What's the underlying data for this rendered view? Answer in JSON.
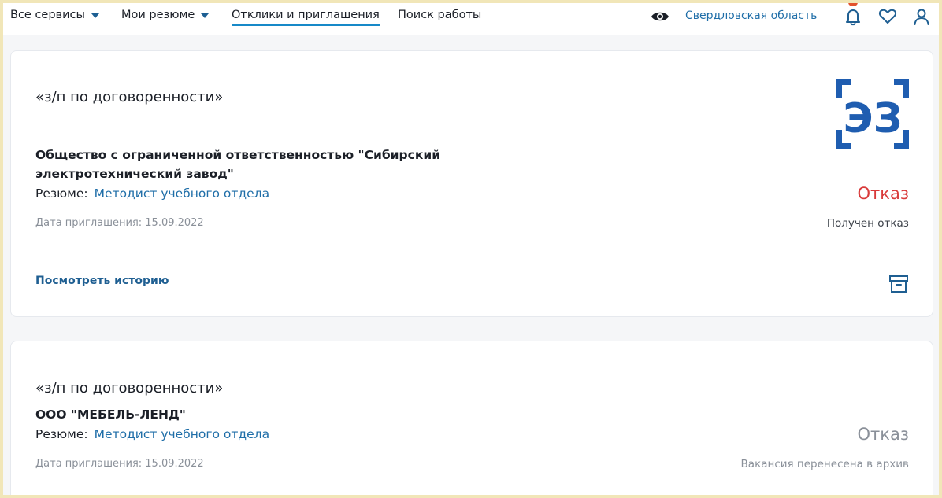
{
  "header": {
    "nav": [
      {
        "label": "Все сервисы",
        "has_dropdown": true
      },
      {
        "label": "Мои резюме",
        "has_dropdown": true
      },
      {
        "label": "Отклики и приглашения",
        "active": true
      },
      {
        "label": "Поиск работы"
      }
    ],
    "region": "Свердловская область",
    "icons": [
      "eye-icon",
      "bell-icon",
      "heart-icon",
      "user-icon"
    ],
    "accent_color": "#1789c8"
  },
  "responses": [
    {
      "salary": "«з/п по договоренности»",
      "company": "Общество с ограниченной ответственностью \"Сибирский электротехнический завод\"",
      "resume_label": "Резюме:",
      "resume_title": "Методист учебного отдела",
      "date": "Дата приглашения: 15.09.2022",
      "status": "Отказ",
      "status_note": "Получен отказ",
      "status_color": "#d93a3a",
      "history_link": "Посмотреть историю",
      "logo_text": "ЭЗ"
    },
    {
      "salary": "«з/п по договоренности»",
      "company": "ООО \"МЕБЕЛЬ-ЛЕНД\"",
      "resume_label": "Резюме:",
      "resume_title": "Методист учебного отдела",
      "date": "Дата приглашения: 15.09.2022",
      "status": "Отказ",
      "status_note": "Вакансия перенесена в архив",
      "status_color": "#8a9099"
    }
  ]
}
